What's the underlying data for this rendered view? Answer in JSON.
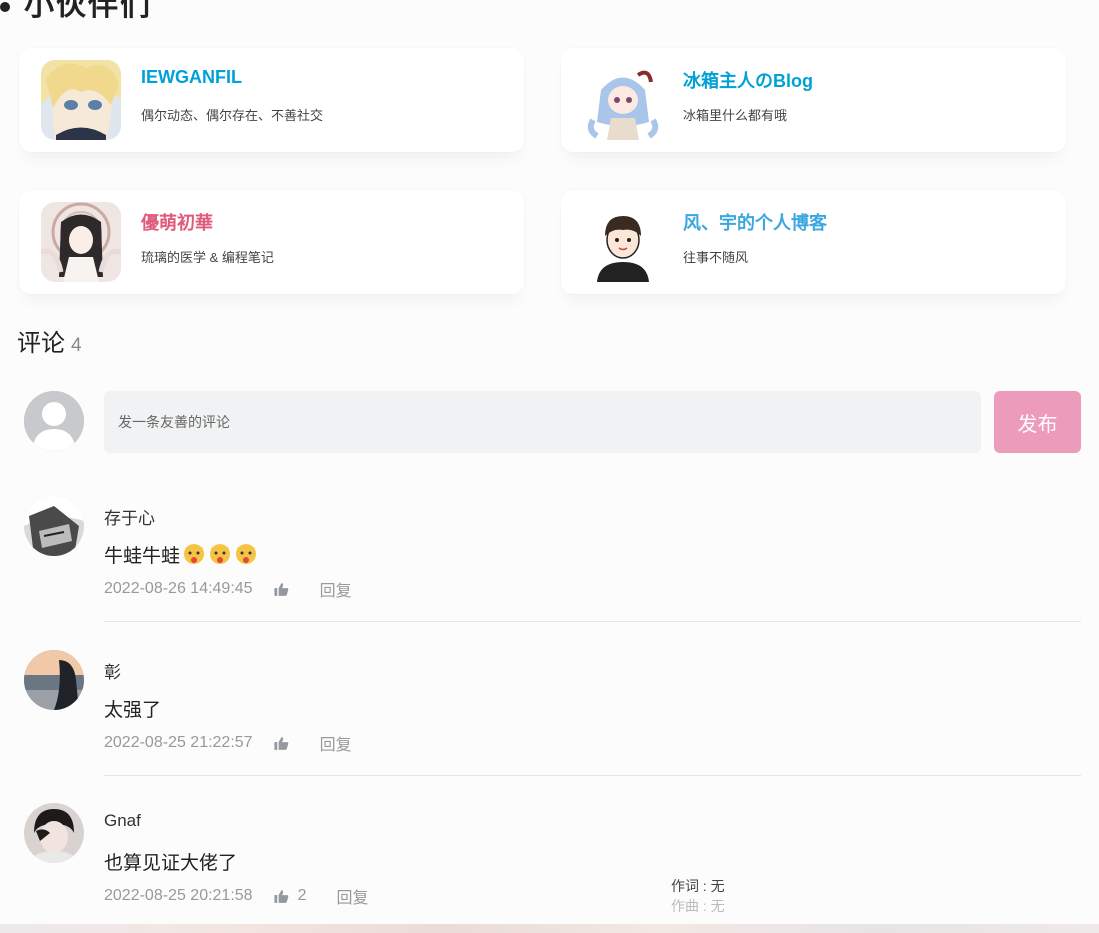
{
  "friends": [
    {
      "name": "IEWGANFIL",
      "desc": "偶尔动态、偶尔存在、不善社交",
      "color": "#00a1d6",
      "avatar_icon": "anime-blonde-avatar-icon"
    },
    {
      "name": "冰箱主人のBlog",
      "desc": "冰箱里什么都有哦",
      "color": "#00a1d6",
      "avatar_icon": "anime-blue-hair-avatar-icon"
    },
    {
      "name": "優萌初華",
      "desc": "琉璃的医学 & 编程笔记",
      "color": "#e05a7a",
      "avatar_icon": "anime-dark-hair-avatar-icon"
    },
    {
      "name": "风、宇的个人博客",
      "desc": "往事不随风",
      "color": "#3aa7e0",
      "avatar_icon": "cartoon-boy-avatar-icon"
    }
  ],
  "comments_section": {
    "title": "评论",
    "count": "4",
    "input_placeholder": "发一条友善的评论",
    "post_label": "发布",
    "post_color": "#ec9bbb"
  },
  "comments": [
    {
      "user": "存于心",
      "text": "牛蛙牛蛙",
      "emoji_count": 3,
      "time": "2022-08-26 14:49:45",
      "likes": "",
      "reply_label": "回复"
    },
    {
      "user": "彰",
      "text": "太强了",
      "emoji_count": 0,
      "time": "2022-08-25 21:22:57",
      "likes": "",
      "reply_label": "回复"
    },
    {
      "user": "Gnaf",
      "text": "也算见证大佬了",
      "emoji_count": 0,
      "time": "2022-08-25 20:21:58",
      "likes": "2",
      "reply_label": "回复"
    }
  ],
  "lyric": {
    "line1": "作词 : 无",
    "line2": "作曲 : 无"
  }
}
